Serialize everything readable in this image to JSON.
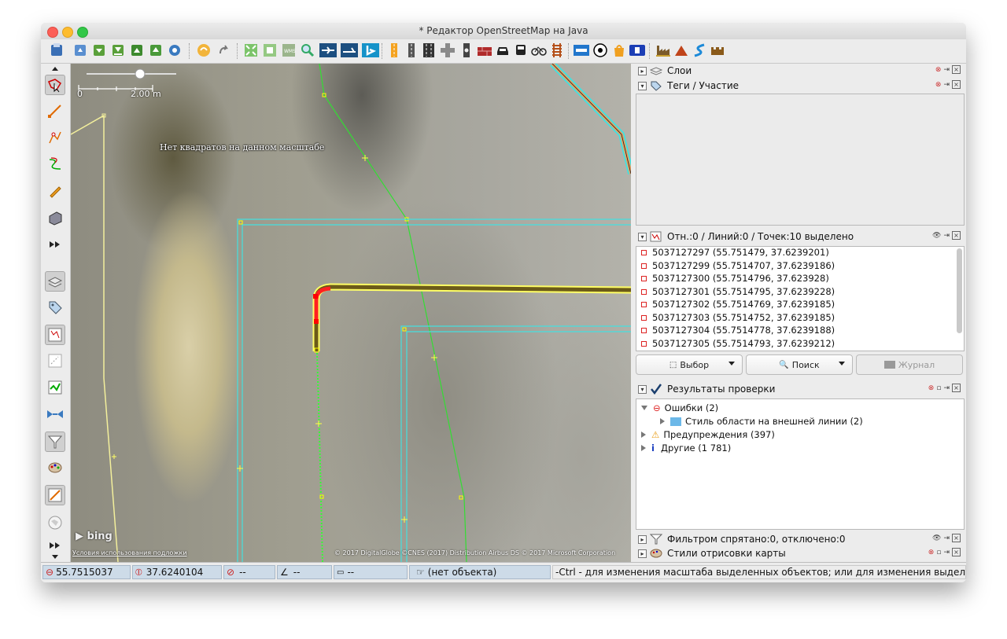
{
  "window": {
    "title": "* Редактор OpenStreetMap на Java"
  },
  "toolbar": {
    "icons": [
      "new-layer-icon",
      "open-file-icon",
      "save-icon",
      "save-as-icon",
      "upload-icon",
      "preferences-icon",
      "undo-icon",
      "redo-icon",
      "zoom-to-data-icon",
      "download-area-icon",
      "imagery-icon",
      "search-places-icon",
      "bing-icon"
    ]
  },
  "map": {
    "scale_start": "0",
    "scale_label": "2.00 m",
    "no_tiles": "Нет квадратов на данном масштабе",
    "bing_logo": "bing",
    "terms_link": "Условия использования подложки",
    "attribution": "© 2017 DigitalGlobe ©CNES (2017) Distribution Airbus DS © 2017 Microsoft Corporation"
  },
  "panels": {
    "layers": {
      "title": "Слои"
    },
    "tags": {
      "title": "Теги / Участие"
    },
    "selection": {
      "title": "Отн.:0 / Линий:0 / Точек:10 выделено",
      "items": [
        "5037127297 (55.751479, 37.6239201)",
        "5037127299 (55.7514707, 37.6239186)",
        "5037127300 (55.7514796, 37.623928)",
        "5037127301 (55.7514795, 37.6239228)",
        "5037127302 (55.7514769, 37.6239185)",
        "5037127303 (55.7514752, 37.6239185)",
        "5037127304 (55.7514778, 37.6239188)",
        "5037127305 (55.7514793, 37.6239212)"
      ],
      "btn_select": "Выбор",
      "btn_search": "Поиск",
      "btn_history": "Журнал"
    },
    "validation": {
      "title": "Результаты проверки",
      "errors": "Ошибки (2)",
      "error_child": "Стиль области на внешней линии (2)",
      "warnings": "Предупреждения (397)",
      "other": "Другие (1 781)"
    },
    "filter": {
      "title": "Фильтром спрятано:0, отключено:0"
    },
    "styles": {
      "title": "Стили отрисовки карты"
    }
  },
  "status": {
    "lat": "55.7515037",
    "lon": "37.6240104",
    "heading": "--",
    "angle": "--",
    "distance": "--",
    "object": "(нет объекта)",
    "hint": "-Ctrl - для изменения масштаба выделенных объектов; или для изменения выделения"
  },
  "colors": {
    "selection": "#ff0000",
    "way_highlight": "#ffff00",
    "area_outline": "#33dddd",
    "footway": "#33dd33",
    "status_field": "#cddbe8"
  }
}
